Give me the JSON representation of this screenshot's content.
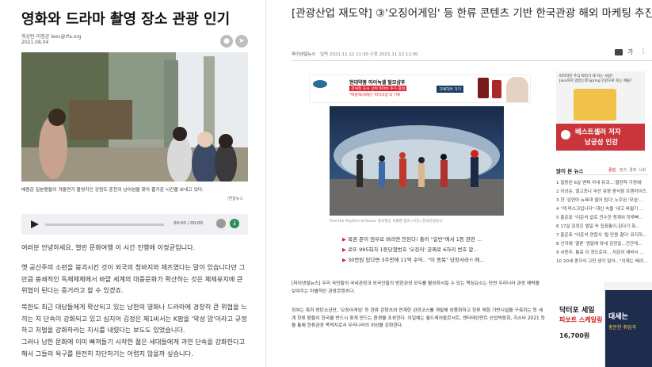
{
  "left": {
    "title": "영화와 드라마 촬영 장소 관광 인기",
    "byline": "워싱턴-이정균 leec@rfa.org",
    "date": "2021.08.04",
    "photo_caption": "배용준 일본팬들이 겨울연가 촬영지인 강원도 춘천의 남이섬을 찾아 즐거운 시간을 보내고 있다.",
    "photo_credit": "/연합뉴스",
    "audio_time": "00:00 / 00:00",
    "paragraphs": [
      "여러분 안녕하세요, 열린 문화여행 이 시간 진행에 이정균입니다.",
      "옛 공산주의 소련을 붕괴시킨 것이 외국의 청바지와 재즈였다는 말이 있습니다만 그만큼 봉쇄적인 독재체제에서 바깥 세계의 대중문화가 확산하는 것은 체제유지에 큰 위협이 된다는 증거라고 할 수 있겠죠.",
      "북한도 최근 대담들에게 확산되고 있는 남한의 영화나 드라마에 경창히 큰 위협을 느끼는 지 단속이 강화되고 있고 심지어 김정은 제1비서는 K팝을 '악성 암'이라고 규정하고 처벌을 강화하라는 지시를 내렸다는 보도도 있었습니다.",
      "그러나 남한 문화에 이미 빠져들기 시작한 젊은 세대들에게 과연 단속을 강화한다고 해서 그들의 욕구를 완전히 차단하기는 어렵지 않을까 싶습니다."
    ]
  },
  "right": {
    "title": "[관광산업 재도약] ③'오징어게임' 등 한류 콘텐츠 기반 한국관광 해외 마케팅 추진",
    "source": "파이낸셜뉴스",
    "timestamps": "입력 2021.11.12 11:30  수정 2021.11.12 11:30",
    "font_label": "가",
    "ad_banner": {
      "brand": "현대약품 마이녹셀 탈모샴푸",
      "line1": "관세청 조사 상위 60ml 추가 증정",
      "line2": "*매출액/세제반 '피아라샵'의 기록",
      "cta": "구매하러 가기"
    },
    "hero_caption": "Feel the Rhythm of Korea' 홍보영상 서울편 캡처 /사진=한국관광공사",
    "related": [
      "목권 준이 엄부로 버리면 안된다! 총이 \"일반\"에서 1등 관련 ...",
      "로또 995회차 1등당첨번호 '오징어' 공짜로 6자리 번호 알...",
      "30만원 있다면 3주만에 11억 수익.. \"이 종목\" 당장사라!! 에..."
    ],
    "body": [
      "[파이낸셜뉴스] 우리 국민들의 국내관광과 외국인들의 방한관광 모두를 활성화시킬 수 있는 핵심요소는 단연 우리나라 관광 매력을 보여주는 차별적인 관광콘텐츠다.",
      "정부는 특히 방탄소년단, '오징어게임' 등 한류 콘텐츠와 연계한 관광코스를 개발해 상품화하고 한류 체험 기반시설을 구축하는 등 세계 한류 팬들이 한국을 반드시 찾게 만드는 환경을 조성한다. 이일에는 월드케어팝콘서트, 엔터테인먼트 산업박람회, 지스타 2021 등을 통해 한류관광 목적지로서 우리나라의 위상을 강화한다."
    ],
    "side_ad": {
      "line1": "따라하던 주식 따라가 세 하는 사람?",
      "line2": "Java하지 않았는데 Spring 인강으로 죽는 애들?",
      "banner": "베스트셀러 저자",
      "banner2": "남궁성 인강"
    },
    "popular": {
      "title": "많이 본 뉴스",
      "tabs": [
        "종합",
        "정치",
        "경제",
        "사회"
      ],
      "items": [
        "1 밀동된 6살 벤짜 아내 유괴...'결장학 가정에'",
        "2 이상순, 얼고포니 부산 유명 음식점 프랜차이즈...",
        "3 한 '김연아 뉴욕대 셀어 됩다',노주된 '모습'...",
        "4 \"게 마스크입니다\".대신 속을 '내고 바뀔기 ...",
        "5 홍준표 \"이준석 없로 전수한 청계위 하루빠...",
        "6 17살 김정은 벌일 속 집중통이,김다기 축...",
        "7 홍준표 \"이준석 연합서 '될 만큼 결다' 유지하...",
        "8 신지에 '결론' 엠알에 닦네 김정일...건간데...",
        "9 서동주, 통료 이 정도로야....저감이 애비서 ...",
        "10 20세 종지식 고민 생각 많아...\"이제는 배려..."
      ]
    },
    "bottom_ad": {
      "line1": "닥터포 세일",
      "line2": "피쏘트 스케일링",
      "price": "16,700원",
      "right1": "대세는",
      "right2": "충분한 취업과"
    }
  }
}
